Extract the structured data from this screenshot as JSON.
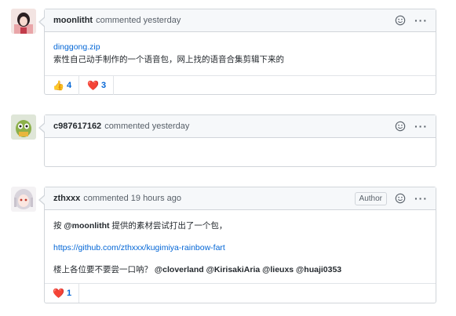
{
  "comments": [
    {
      "author": "moonlitht",
      "meta": "commented yesterday",
      "file_link": "dinggong.zip",
      "text": "索性自己动手制作的一个语音包，网上找的语音合集剪辑下来的",
      "reactions": [
        {
          "emoji": "thumbs-up",
          "glyph": "👍",
          "count": "4"
        },
        {
          "emoji": "heart",
          "glyph": "❤️",
          "count": "3"
        }
      ]
    },
    {
      "author": "c987617162",
      "meta": "commented yesterday"
    },
    {
      "author": "zthxxx",
      "meta": "commented 19 hours ago",
      "badge": "Author",
      "line1_prefix": "按 ",
      "line1_mention": "@moonlitht",
      "line1_suffix": " 提供的素材尝试打出了一个包，",
      "repo_link": "https://github.com/zthxxx/kugimiya-rainbow-fart",
      "line3_prefix": "楼上各位要不要尝一口呐？ ",
      "line3_mentions": "@cloverland @KirisakiAria @lieuxs @huaji0353",
      "reactions": [
        {
          "emoji": "heart",
          "glyph": "❤️",
          "count": "1"
        }
      ]
    }
  ],
  "more_glyph": "···",
  "colors": {
    "link": "#0366d6",
    "border": "#d1d5da",
    "header_bg": "#f6f8fa",
    "heart": "#e0245e"
  }
}
